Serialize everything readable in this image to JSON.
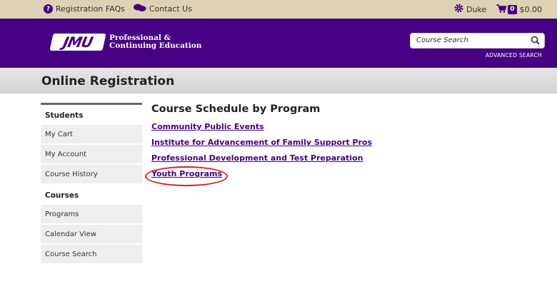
{
  "topbar": {
    "faq_label": "Registration FAQs",
    "contact_label": "Contact Us",
    "user_name": "Duke",
    "cart_count": "0",
    "cart_total": "$0.00"
  },
  "header": {
    "logo_mark": "JMU",
    "logo_line1": "Professional &",
    "logo_line2": "Continuing Education",
    "search_placeholder": "Course Search",
    "advanced_search_label": "ADVANCED SEARCH"
  },
  "page_title": "Online Registration",
  "sidebar": {
    "sections": [
      {
        "heading": "Students",
        "items": [
          "My Cart",
          "My Account",
          "Course History"
        ]
      },
      {
        "heading": "Courses",
        "items": [
          "Programs",
          "Calendar View",
          "Course Search"
        ]
      }
    ]
  },
  "main": {
    "heading": "Course Schedule by Program",
    "programs": [
      "Community Public Events",
      "Institute for Advancement of Family Support Pros",
      "Professional Development and Test Preparation",
      "Youth Programs"
    ]
  },
  "colors": {
    "brand_purple": "#450084",
    "topbar_gold": "#ddd3b4",
    "highlight_red": "#d42020"
  }
}
